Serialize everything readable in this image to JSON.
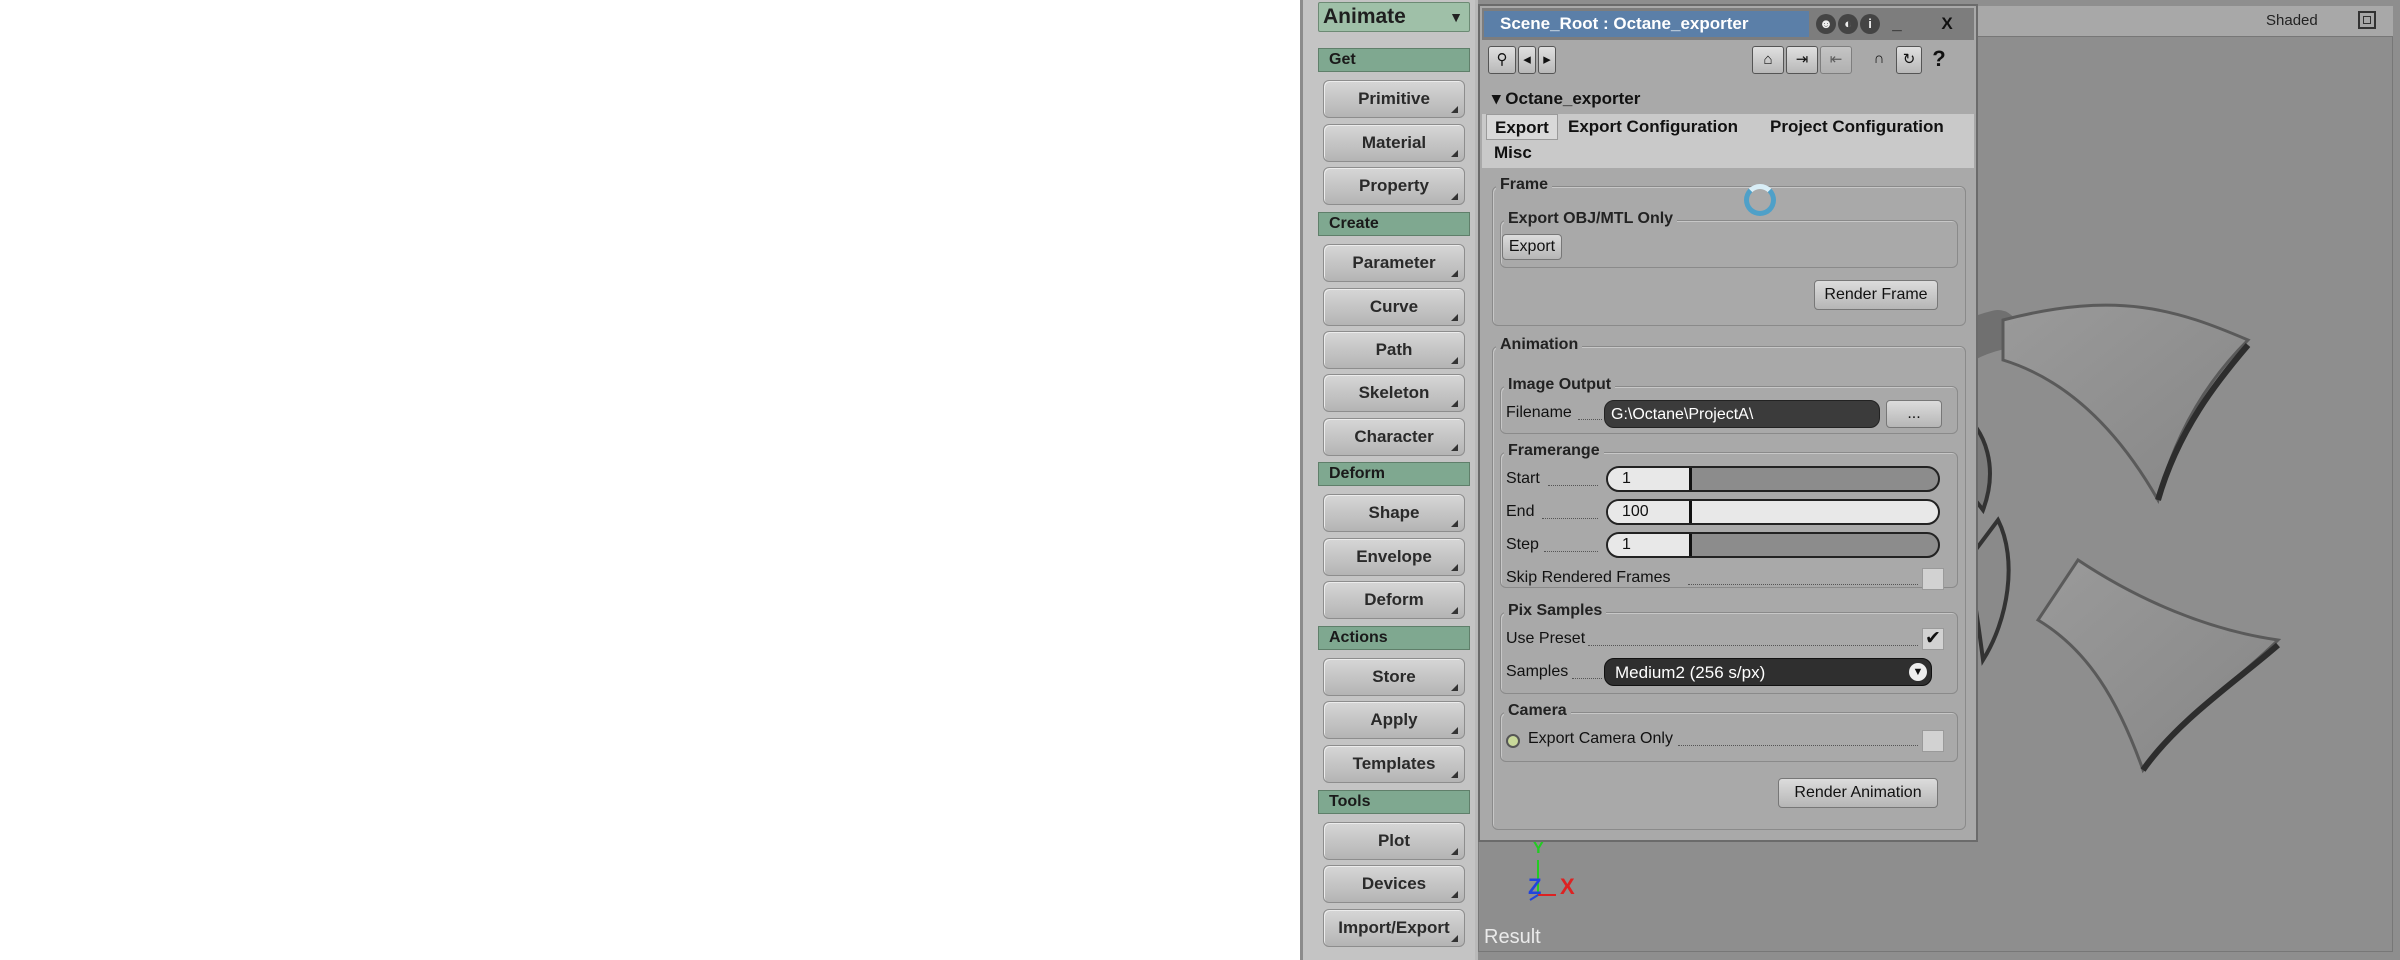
{
  "left_panel": {
    "mode": "Animate",
    "sections": [
      {
        "title": "Get",
        "buttons": [
          "Primitive",
          "Material",
          "Property"
        ]
      },
      {
        "title": "Create",
        "buttons": [
          "Parameter",
          "Curve",
          "Path",
          "Skeleton",
          "Character"
        ]
      },
      {
        "title": "Deform",
        "buttons": [
          "Shape",
          "Envelope",
          "Deform"
        ]
      },
      {
        "title": "Actions",
        "buttons": [
          "Store",
          "Apply",
          "Templates"
        ]
      },
      {
        "title": "Tools",
        "buttons": [
          "Plot",
          "Devices",
          "Import/Export"
        ]
      }
    ]
  },
  "viewport": {
    "shading_mode": "Shaded",
    "label": "Result",
    "axes": {
      "x": "X",
      "y": "Y",
      "z": "Z"
    }
  },
  "dialog": {
    "title": "Scene_Root : Octane_exporter",
    "property_name": "Octane_exporter",
    "tabs": [
      "Export",
      "Export Configuration",
      "Project Configuration",
      "Misc"
    ],
    "toolbar": {
      "minimize": "_",
      "close": "X",
      "help": "?"
    },
    "frame": {
      "title": "Frame",
      "export_group_title": "Export OBJ/MTL Only",
      "export_button": "Export",
      "render_frame_button": "Render Frame"
    },
    "animation": {
      "title": "Animation",
      "image_output": {
        "title": "Image Output",
        "filename_label": "Filename",
        "filename_value": "G:\\Octane\\ProjectA\\",
        "browse_button": "..."
      },
      "framerange": {
        "title": "Framerange",
        "start_label": "Start",
        "start_value": "1",
        "end_label": "End",
        "end_value": "100",
        "step_label": "Step",
        "step_value": "1",
        "skip_label": "Skip Rendered Frames"
      },
      "pix_samples": {
        "title": "Pix Samples",
        "use_preset_label": "Use Preset",
        "samples_label": "Samples",
        "samples_value": "Medium2 (256 s/px)"
      },
      "camera": {
        "title": "Camera",
        "export_camera_only_label": "Export Camera Only"
      },
      "render_animation_button": "Render Animation"
    }
  },
  "colors": {
    "title_bar": "#5b7fa8",
    "section_header": "#7fa890",
    "viewport_bg": "#8e8e8e"
  }
}
